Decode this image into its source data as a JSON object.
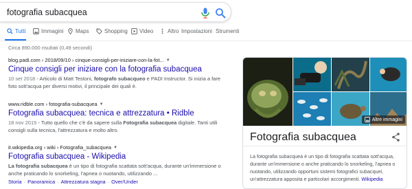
{
  "search": {
    "query": "fotografia subacquea"
  },
  "tabs": [
    {
      "label": "Tutti",
      "icon": "search-icon",
      "active": true
    },
    {
      "label": "Immagini",
      "icon": "image-icon"
    },
    {
      "label": "Maps",
      "icon": "map-icon"
    },
    {
      "label": "Shopping",
      "icon": "tag-icon"
    },
    {
      "label": "Video",
      "icon": "video-icon"
    },
    {
      "label": "Altro",
      "icon": "more-vert-icon"
    },
    {
      "label": "Impostazioni"
    },
    {
      "label": "Strumenti"
    }
  ],
  "stats": "Circa 890.000 risultati (0,49 secondi)",
  "results": [
    {
      "url": "blog.padi.com › 2018/09/10 › cinque-consigli-per-iniziare-con-la-fot...",
      "title": "Cinque consigli per iniziare con la fotografia subacquea",
      "date": "10 set 2018",
      "snippet_a": " - Articolo di Matt Testoni, ",
      "snippet_b": "fotografo subacqueo",
      "snippet_c": " e PADI Instructor. Si inizia a fare foto sott'acqua per diversi motivi, il principale dei quali è."
    },
    {
      "url": "www.ridble.com › fotografia-subacquea",
      "title": "Fotografia subacquea: tecnica e attrezzatura • Ridble",
      "date": "18 nov 2015",
      "snippet_a": " - Tutto quello che c'è da sapere sulla ",
      "snippet_b": "Fotografia subacquea",
      "snippet_c": " digitale. Tanti utili consigli sulla tecnica, l'attrezzatura e molto altro."
    },
    {
      "url": "it.wikipedia.org › wiki › Fotografia_subacquea",
      "title": "Fotografia subacquea - Wikipedia",
      "snippet_b": "La fotografia subacquea",
      "snippet_c": " è un tipo di fotografia scattata sott'acqua, durante un'immersione o anche praticando lo snorkeling, l'apnea o nuotando, utilizzando ...",
      "sitelinks": [
        "Storia",
        "Panoramica",
        "Attrezzatura stagna",
        "Over/Under"
      ]
    }
  ],
  "knowledge_panel": {
    "title": "Fotografia subacquea",
    "more_images": "Altre immagini",
    "description": "La fotografia subacquea è un tipo di fotografia scattata sott'acqua, durante un'immersione o anche praticando lo snorkeling, l'apnea o nuotando, utilizzando opportuni sistemi fotografici subacquei, un'attrezzatura apposita e particolari accorgimenti.",
    "source": "Wikipedia"
  },
  "colors": {
    "link": "#1a0dab",
    "accent": "#1a73e8",
    "text": "#202124",
    "secondary": "#70757a"
  }
}
